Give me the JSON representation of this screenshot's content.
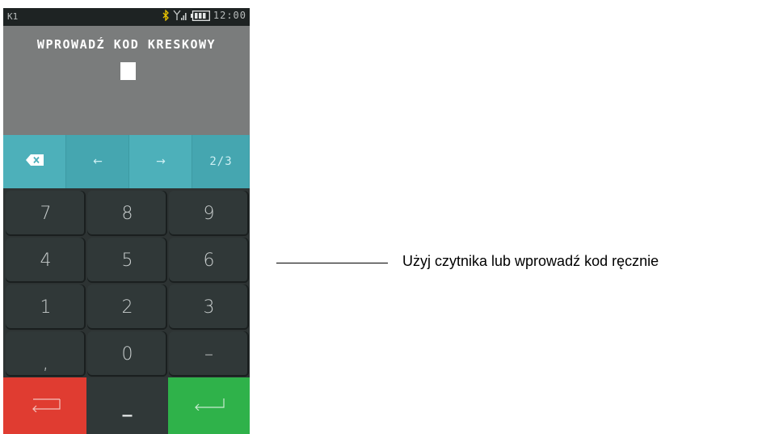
{
  "status_bar": {
    "left_label": "K1",
    "clock": "12:00",
    "icons": [
      "bluetooth-icon",
      "signal-icon",
      "battery-icon"
    ]
  },
  "display": {
    "prompt": "WPROWADŹ KOD KRESKOWY"
  },
  "function_keys": {
    "backspace_icon": "backspace-icon",
    "left_arrow": "←",
    "right_arrow": "→",
    "page": "2/3"
  },
  "numpad": {
    "keys": [
      "7",
      "8",
      "9",
      "4",
      "5",
      "6",
      "1",
      "2",
      "3",
      ",",
      "0",
      "–"
    ]
  },
  "action_keys": {
    "cancel_icon": "return-left-icon",
    "underscore": "_",
    "enter_icon": "enter-icon",
    "cancel_color": "#e03c31",
    "enter_color": "#2fb24a"
  },
  "callout": {
    "text": "Użyj czytnika lub wprowadź kod ręcznie"
  },
  "colors": {
    "device_bg": "#2d3333",
    "display_bg": "#7a7c7c",
    "function_key_bg": "#4db0ba"
  }
}
